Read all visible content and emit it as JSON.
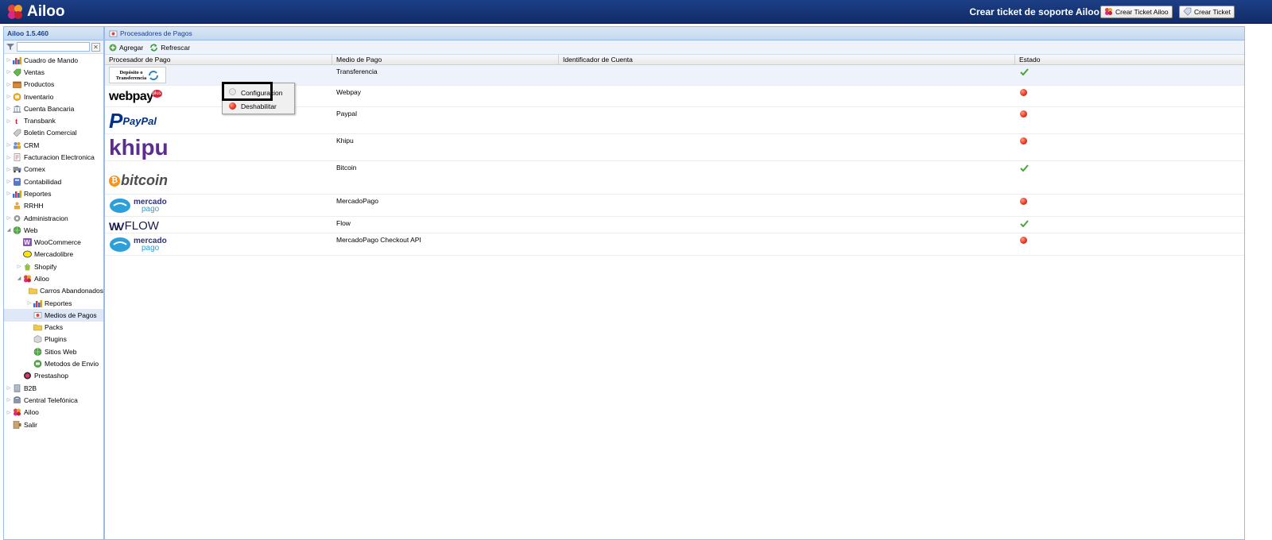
{
  "app": {
    "logo_text": "Ailoo",
    "support_title": "Crear ticket de soporte Ailoo ☛",
    "btn_ticket_ailoo": "Crear Ticket Ailoo",
    "btn_ticket": "Crear Ticket",
    "colors": {
      "topbar": "#1d3f86",
      "panel_header": "#15428b",
      "border": "#99bbe8",
      "selected": "#dfe8f6"
    }
  },
  "sidebar": {
    "version": "Ailoo 1.5.460",
    "filter_clear": "✕",
    "items": [
      {
        "label": "Cuadro de Mando",
        "icon": "chart-icon",
        "arrow": "▷",
        "level": 0
      },
      {
        "label": "Ventas",
        "icon": "tag-icon",
        "arrow": "▷",
        "level": 0
      },
      {
        "label": "Productos",
        "icon": "box-icon",
        "arrow": "▷",
        "level": 0
      },
      {
        "label": "Inventario",
        "icon": "inventory-icon",
        "arrow": "▷",
        "level": 0
      },
      {
        "label": "Cuenta Bancaria",
        "icon": "bank-icon",
        "arrow": "▷",
        "level": 0
      },
      {
        "label": "Transbank",
        "icon": "transbank-icon",
        "arrow": "▷",
        "level": 0
      },
      {
        "label": "Boletin Comercial",
        "icon": "label-icon",
        "arrow": "",
        "level": 0
      },
      {
        "label": "CRM",
        "icon": "crm-icon",
        "arrow": "▷",
        "level": 0
      },
      {
        "label": "Facturacion Electronica",
        "icon": "invoice-icon",
        "arrow": "▷",
        "level": 0
      },
      {
        "label": "Comex",
        "icon": "truck-icon",
        "arrow": "▷",
        "level": 0
      },
      {
        "label": "Contabilidad",
        "icon": "calculator-icon",
        "arrow": "▷",
        "level": 0
      },
      {
        "label": "Reportes",
        "icon": "chart-icon",
        "arrow": "▷",
        "level": 0
      },
      {
        "label": "RRHH",
        "icon": "people-icon",
        "arrow": "",
        "level": 0
      },
      {
        "label": "Administracion",
        "icon": "gear-icon",
        "arrow": "▷",
        "level": 0
      },
      {
        "label": "Web",
        "icon": "globe-icon",
        "arrow": "◢",
        "level": 0
      },
      {
        "label": "WooCommerce",
        "icon": "woocommerce-icon",
        "arrow": "",
        "level": 1
      },
      {
        "label": "Mercadolibre",
        "icon": "mercadolibre-icon",
        "arrow": "",
        "level": 1
      },
      {
        "label": "Shopify",
        "icon": "shopify-icon",
        "arrow": "▷",
        "level": 1
      },
      {
        "label": "Ailoo",
        "icon": "ailoo-icon",
        "arrow": "◢",
        "level": 1
      },
      {
        "label": "Carros Abandonados",
        "icon": "folder-icon",
        "arrow": "",
        "level": 2
      },
      {
        "label": "Reportes",
        "icon": "chart-icon",
        "arrow": "▷",
        "level": 2
      },
      {
        "label": "Medios de Pagos",
        "icon": "payment-icon",
        "arrow": "",
        "level": 2,
        "selected": true
      },
      {
        "label": "Packs",
        "icon": "folder-icon",
        "arrow": "",
        "level": 2
      },
      {
        "label": "Plugins",
        "icon": "plugin-icon",
        "arrow": "",
        "level": 2
      },
      {
        "label": "Sitios Web",
        "icon": "globe-icon",
        "arrow": "",
        "level": 2
      },
      {
        "label": "Metodos de Envio",
        "icon": "shipping-icon",
        "arrow": "",
        "level": 2
      },
      {
        "label": "Prestashop",
        "icon": "prestashop-icon",
        "arrow": "",
        "level": 1
      },
      {
        "label": "B2B",
        "icon": "building-icon",
        "arrow": "▷",
        "level": 0
      },
      {
        "label": "Central Telefónica",
        "icon": "phone-icon",
        "arrow": "▷",
        "level": 0
      },
      {
        "label": "Ailoo",
        "icon": "ailoo-icon",
        "arrow": "▷",
        "level": 0
      },
      {
        "label": "Salir",
        "icon": "exit-icon",
        "arrow": "",
        "level": 0
      }
    ]
  },
  "main": {
    "title": "Procesadores de Pagos",
    "toolbar": {
      "add": "Agregar",
      "refresh": "Refrescar"
    },
    "columns": [
      "Procesador de Pago",
      "Medio de Pago",
      "Identificador de Cuenta",
      "Estado"
    ],
    "rows": [
      {
        "logo": "transferencia",
        "medio": "Transferencia",
        "id": "",
        "estado": "ok"
      },
      {
        "logo": "webpay",
        "medio": "Webpay",
        "id": "",
        "estado": "off"
      },
      {
        "logo": "paypal",
        "medio": "Paypal",
        "id": "",
        "estado": "off"
      },
      {
        "logo": "khipu",
        "medio": "Khipu",
        "id": "",
        "estado": "off"
      },
      {
        "logo": "bitcoin",
        "medio": "Bitcoin",
        "id": "",
        "estado": "ok"
      },
      {
        "logo": "mercadopago",
        "medio": "MercadoPago",
        "id": "",
        "estado": "off"
      },
      {
        "logo": "flow",
        "medio": "Flow",
        "id": "",
        "estado": "ok"
      },
      {
        "logo": "mercadopago",
        "medio": "MercadoPago Checkout API",
        "id": "",
        "estado": "off"
      }
    ],
    "logo_text": {
      "transferencia_1": "Depósito o",
      "transferencia_2": "Transferencia",
      "webpay": "webpay",
      "webpay_plus": "plus",
      "paypal": "PayPal",
      "khipu": "khipu",
      "bitcoin": "bitcoin",
      "mercado_1": "mercado",
      "mercado_2": "pago",
      "flow": "FLOW"
    }
  },
  "context_menu": {
    "items": [
      "Configuracion",
      "Deshabilitar"
    ]
  }
}
